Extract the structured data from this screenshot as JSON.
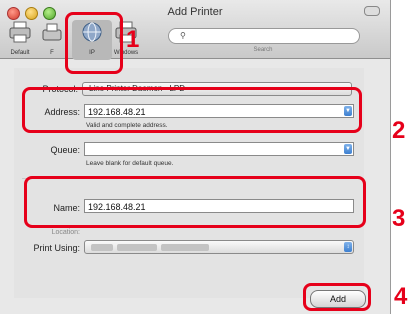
{
  "window": {
    "title": "Add Printer"
  },
  "toolbar": {
    "items": [
      {
        "label": "Default",
        "icon": "printer-icon"
      },
      {
        "label": "F",
        "icon": "fax-icon"
      },
      {
        "label": "IP",
        "icon": "globe-icon"
      },
      {
        "label": "Windows",
        "icon": "windows-printer-icon"
      }
    ],
    "search_label": "Search",
    "search_value": ""
  },
  "form": {
    "protocol_label": "Protocol:",
    "protocol_value": "Line Printer Daemon - LPD",
    "address_label": "Address:",
    "address_value": "192.168.48.21",
    "address_hint": "Valid and complete address.",
    "queue_label": "Queue:",
    "queue_value": "",
    "queue_hint": "Leave blank for default queue.",
    "name_label": "Name:",
    "name_value": "192.168.48.21",
    "location_label": "Location:",
    "print_using_label": "Print Using:",
    "print_using_value": "",
    "add_label": "Add"
  },
  "callouts": [
    "1",
    "2",
    "3",
    "4"
  ],
  "colors": {
    "highlight": "#e6001a",
    "accent": "#3c7fd0"
  }
}
